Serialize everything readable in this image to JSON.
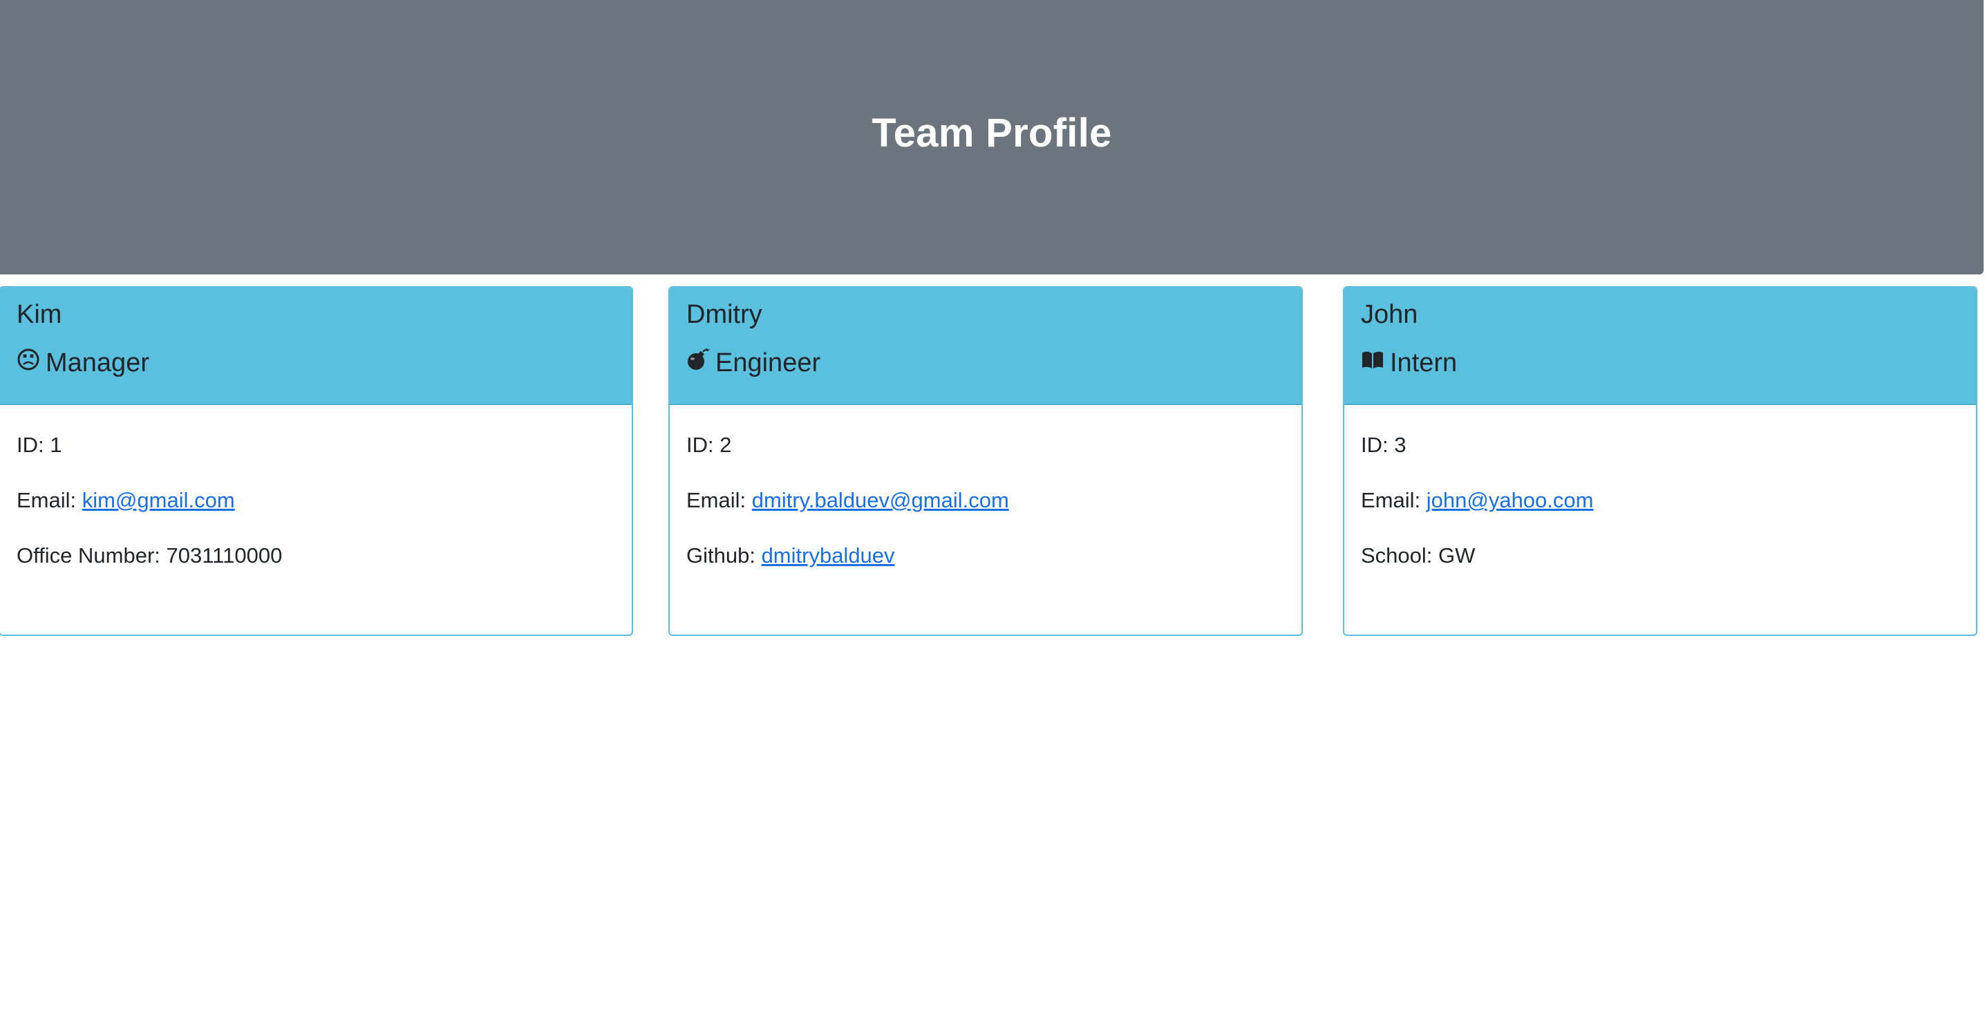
{
  "header": {
    "title": "Team Profile"
  },
  "cards": [
    {
      "name": "Kim",
      "role": "Manager",
      "role_icon": "frown-face-icon",
      "id_label": "ID: 1",
      "email_label": "Email: ",
      "email": "kim@gmail.com",
      "extra_label": "Office Number: 7031110000",
      "extra_link": ""
    },
    {
      "name": "Dmitry",
      "role": "Engineer",
      "role_icon": "bomb-icon",
      "id_label": "ID: 2",
      "email_label": "Email: ",
      "email": "dmitry.balduev@gmail.com",
      "extra_label": "Github: ",
      "extra_link": "dmitrybalduev"
    },
    {
      "name": "John",
      "role": "Intern",
      "role_icon": "open-book-icon",
      "id_label": "ID: 3",
      "email_label": "Email: ",
      "email": "john@yahoo.com",
      "extra_label": "School: GW",
      "extra_link": ""
    }
  ],
  "colors": {
    "header_bg": "#6c757d",
    "card_header_bg": "#5bc0de",
    "link": "#1a6fe3"
  }
}
